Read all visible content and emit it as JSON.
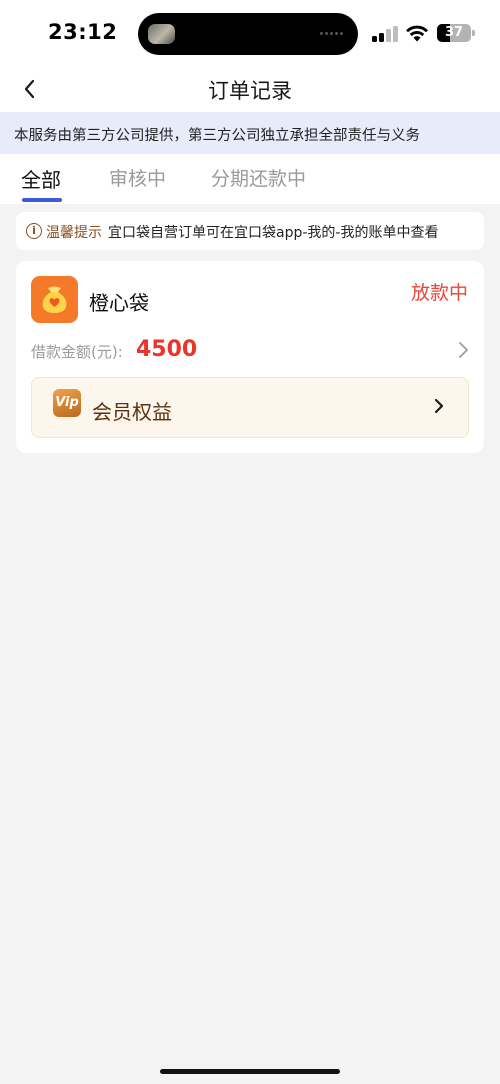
{
  "status_bar": {
    "time": "23:12",
    "battery": "37"
  },
  "nav": {
    "title": "订单记录",
    "back_icon": "chevron-left-icon"
  },
  "notice": {
    "text": "本服务由第三方公司提供，第三方公司独立承担全部责任与义务"
  },
  "tabs": [
    {
      "label": "全部",
      "active": true
    },
    {
      "label": "审核中",
      "active": false
    },
    {
      "label": "分期还款中",
      "active": false
    }
  ],
  "tip": {
    "icon": "info-circle-icon",
    "label": "温馨提示",
    "text": "宜口袋自营订单可在宜口袋app-我的-我的账单中查看"
  },
  "order": {
    "app_name": "橙心袋",
    "status": "放款中",
    "amount_label": "借款金额(元):",
    "amount": "4500",
    "vip_label": "会员权益",
    "vip_icon_text": "Vip"
  },
  "colors": {
    "accent": "#3d5bd6",
    "status_red": "#e8483a",
    "amount_red": "#e8362a",
    "notice_bg": "#e8ebf9",
    "tip_brown": "#8a4f20",
    "logo_orange": "#f47a2a",
    "vip_bg": "#fdf6ec"
  }
}
